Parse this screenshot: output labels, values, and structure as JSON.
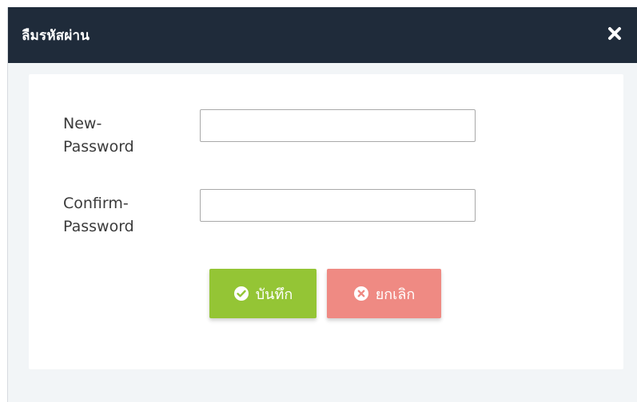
{
  "modal": {
    "title": "ลืมรหัสผ่าน",
    "close_icon": "close-icon"
  },
  "form": {
    "new_password": {
      "label_line1": "New-",
      "label_line2": "Password",
      "value": "",
      "placeholder": ""
    },
    "confirm_password": {
      "label_line1": "Confirm-",
      "label_line2": "Password",
      "value": "",
      "placeholder": ""
    }
  },
  "buttons": {
    "save_label": "บันทึก",
    "save_icon": "check-circle-icon",
    "save_color": "#94c535",
    "cancel_label": "ยกเลิก",
    "cancel_icon": "times-circle-icon",
    "cancel_color": "#ef8a83"
  },
  "colors": {
    "header_bg": "#1f2b3a",
    "modal_bg": "#f2f5f7"
  }
}
